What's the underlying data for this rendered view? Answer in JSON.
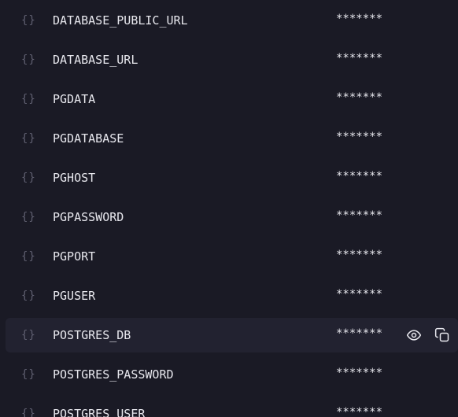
{
  "variables": [
    {
      "name": "DATABASE_PUBLIC_URL",
      "value": "*******",
      "brace": "{}"
    },
    {
      "name": "DATABASE_URL",
      "value": "*******",
      "brace": "{}"
    },
    {
      "name": "PGDATA",
      "value": "*******",
      "brace": "{}"
    },
    {
      "name": "PGDATABASE",
      "value": "*******",
      "brace": "{}"
    },
    {
      "name": "PGHOST",
      "value": "*******",
      "brace": "{}"
    },
    {
      "name": "PGPASSWORD",
      "value": "*******",
      "brace": "{}"
    },
    {
      "name": "PGPORT",
      "value": "*******",
      "brace": "{}"
    },
    {
      "name": "PGUSER",
      "value": "*******",
      "brace": "{}"
    },
    {
      "name": "POSTGRES_DB",
      "value": "*******",
      "brace": "{}"
    },
    {
      "name": "POSTGRES_PASSWORD",
      "value": "*******",
      "brace": "{}"
    },
    {
      "name": "POSTGRES_USER",
      "value": "*******",
      "brace": "{}"
    }
  ],
  "hovered_row": "POSTGRES_DB",
  "icons": {
    "reveal": "eye-icon",
    "copy": "copy-icon",
    "variable": "braces-icon"
  },
  "colors": {
    "background": "#1a1a25",
    "hover_row": "#222230",
    "text": "#e8e8ee",
    "muted": "#5f5f70"
  }
}
